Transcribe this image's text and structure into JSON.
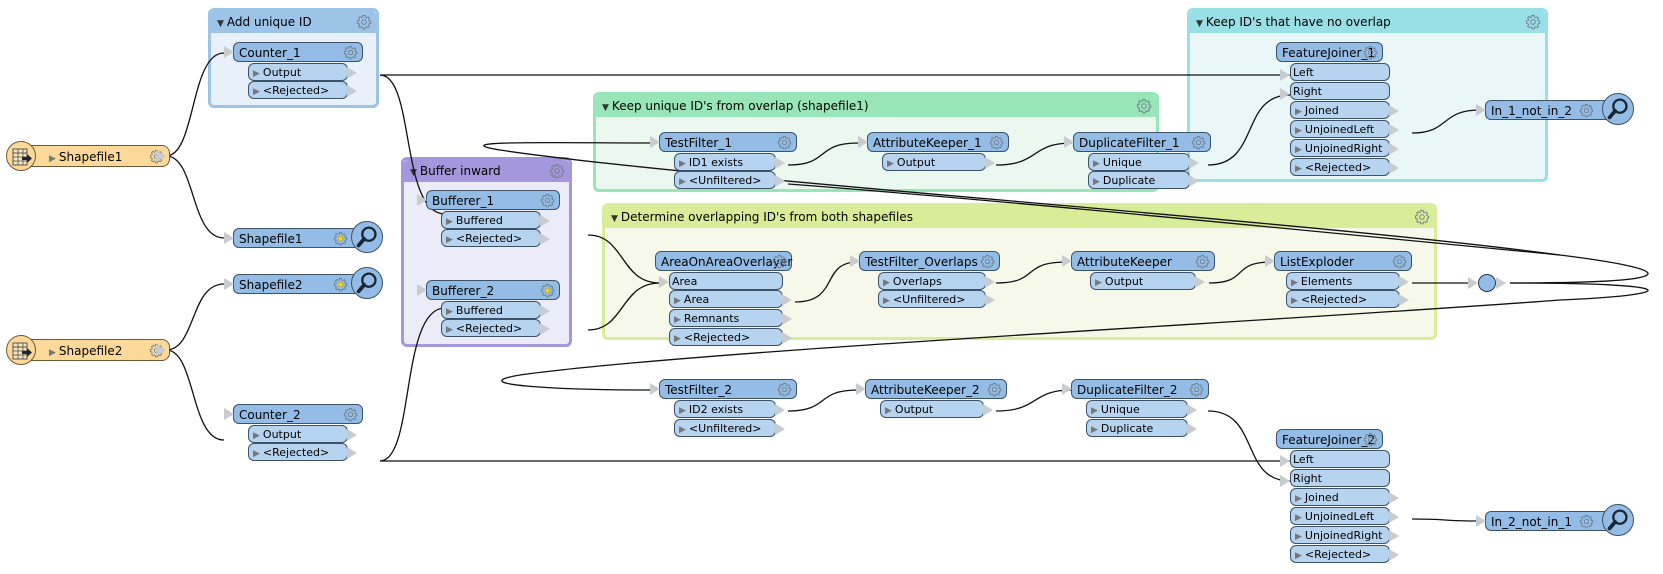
{
  "canvas": {
    "background": "#ffffff"
  },
  "colors": {
    "transformer": "#93bde6",
    "port": "#b6d4f0",
    "reader": "#fdd999",
    "bookmark_blue": "#9cc3e8",
    "bookmark_purple": "#a597dd",
    "bookmark_green": "#98e6b7",
    "bookmark_lime": "#d9ec98",
    "bookmark_cyan": "#98dfe6"
  },
  "bookmarks": {
    "add_unique_id": {
      "title": "Add unique ID",
      "icon": "gear-icon"
    },
    "buffer_inward": {
      "title": "Buffer inward",
      "icon": "gear-icon"
    },
    "keep_unique_overlap": {
      "title": "Keep unique ID's from overlap (shapefile1)",
      "icon": "gear-icon"
    },
    "determine_overlapping": {
      "title": "Determine overlapping ID's from both shapefiles",
      "icon": "gear-icon"
    },
    "keep_no_overlap": {
      "title": "Keep ID's that have no overlap",
      "icon": "gear-icon"
    }
  },
  "readers": [
    {
      "name": "Shapefile1",
      "icon": "table-reader-icon"
    },
    {
      "name": "Shapefile2",
      "icon": "table-reader-icon"
    }
  ],
  "transformers": {
    "counter_1": {
      "name": "Counter_1",
      "outputs": [
        "Output",
        "<Rejected>"
      ]
    },
    "counter_2": {
      "name": "Counter_2",
      "outputs": [
        "Output",
        "<Rejected>"
      ]
    },
    "inspector_sf1": {
      "name": "Shapefile1"
    },
    "inspector_sf2": {
      "name": "Shapefile2"
    },
    "bufferer_1": {
      "name": "Bufferer_1",
      "outputs": [
        "Buffered",
        "<Rejected>"
      ]
    },
    "bufferer_2": {
      "name": "Bufferer_2",
      "outputs": [
        "Buffered",
        "<Rejected>"
      ]
    },
    "testfilter_1": {
      "name": "TestFilter_1",
      "outputs": [
        "ID1 exists",
        "<Unfiltered>"
      ]
    },
    "attributekeeper_1": {
      "name": "AttributeKeeper_1",
      "outputs": [
        "Output"
      ]
    },
    "duplicatefilter_1": {
      "name": "DuplicateFilter_1",
      "outputs": [
        "Unique",
        "Duplicate"
      ]
    },
    "areaonarea": {
      "name": "AreaOnAreaOverlayer",
      "inputs": [
        "Area"
      ],
      "outputs": [
        "Area",
        "Remnants",
        "<Rejected>"
      ]
    },
    "testfilter_overlaps": {
      "name": "TestFilter_Overlaps",
      "outputs": [
        "Overlaps",
        "<Unfiltered>"
      ]
    },
    "attributekeeper": {
      "name": "AttributeKeeper",
      "outputs": [
        "Output"
      ]
    },
    "listexploder": {
      "name": "ListExploder",
      "outputs": [
        "Elements",
        "<Rejected>"
      ]
    },
    "featurejoiner_1": {
      "name": "FeatureJoiner_1",
      "inputs": [
        "Left",
        "Right"
      ],
      "outputs": [
        "Joined",
        "UnjoinedLeft",
        "UnjoinedRight",
        "<Rejected>"
      ]
    },
    "in_1_not_in_2": {
      "name": "In_1_not_in_2"
    },
    "testfilter_2": {
      "name": "TestFilter_2",
      "outputs": [
        "ID2 exists",
        "<Unfiltered>"
      ]
    },
    "attributekeeper_2": {
      "name": "AttributeKeeper_2",
      "outputs": [
        "Output"
      ]
    },
    "duplicatefilter_2": {
      "name": "DuplicateFilter_2",
      "outputs": [
        "Unique",
        "Duplicate"
      ]
    },
    "featurejoiner_2": {
      "name": "FeatureJoiner_2",
      "inputs": [
        "Left",
        "Right"
      ],
      "outputs": [
        "Joined",
        "UnjoinedLeft",
        "UnjoinedRight",
        "<Rejected>"
      ]
    },
    "in_2_not_in_1": {
      "name": "In_2_not_in_1"
    }
  },
  "connections": [
    {
      "from": "Shapefile1 reader",
      "to": "Counter_1"
    },
    {
      "from": "Shapefile1 reader",
      "to": "Shapefile1 inspector"
    },
    {
      "from": "Shapefile2 reader",
      "to": "Shapefile2 inspector"
    },
    {
      "from": "Shapefile2 reader",
      "to": "Counter_2"
    },
    {
      "from": "Counter_1.Output",
      "to": "Bufferer_1"
    },
    {
      "from": "Counter_1.Output",
      "to": "FeatureJoiner_1.Left"
    },
    {
      "from": "Counter_2.Output",
      "to": "Bufferer_2"
    },
    {
      "from": "Counter_2.Output",
      "to": "FeatureJoiner_2.Left"
    },
    {
      "from": "Bufferer_1.Buffered",
      "to": "AreaOnAreaOverlayer.Area"
    },
    {
      "from": "Bufferer_2.Buffered",
      "to": "AreaOnAreaOverlayer.Area"
    },
    {
      "from": "AreaOnAreaOverlayer.Area",
      "to": "TestFilter_Overlaps"
    },
    {
      "from": "TestFilter_Overlaps.Overlaps",
      "to": "AttributeKeeper"
    },
    {
      "from": "AttributeKeeper.Output",
      "to": "ListExploder"
    },
    {
      "from": "ListExploder.Elements",
      "to": "Junction"
    },
    {
      "from": "Junction",
      "to": "TestFilter_1"
    },
    {
      "from": "Junction",
      "to": "TestFilter_2"
    },
    {
      "from": "TestFilter_1.ID1 exists",
      "to": "AttributeKeeper_1"
    },
    {
      "from": "AttributeKeeper_1.Output",
      "to": "DuplicateFilter_1"
    },
    {
      "from": "DuplicateFilter_1.Unique",
      "to": "FeatureJoiner_1.Right"
    },
    {
      "from": "FeatureJoiner_1.UnjoinedLeft",
      "to": "In_1_not_in_2"
    },
    {
      "from": "TestFilter_2.ID2 exists",
      "to": "AttributeKeeper_2"
    },
    {
      "from": "AttributeKeeper_2.Output",
      "to": "DuplicateFilter_2"
    },
    {
      "from": "DuplicateFilter_2.Unique",
      "to": "FeatureJoiner_2.Right"
    },
    {
      "from": "FeatureJoiner_2.UnjoinedLeft",
      "to": "In_2_not_in_1"
    }
  ]
}
